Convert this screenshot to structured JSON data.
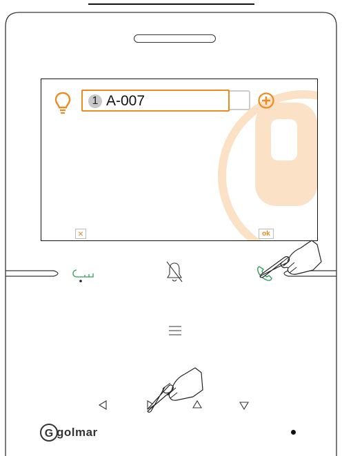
{
  "screen": {
    "entry_index": "1",
    "entry_name": "A-007",
    "cancel_label": "×",
    "ok_label": "ok"
  },
  "brand": {
    "logo_text": "golmar",
    "logo_letter": "G"
  },
  "colors": {
    "accent": "#f0891e",
    "green": "#2e9e5b",
    "watermark": "#fbe1c6",
    "outline": "#333333"
  },
  "icons": {
    "lamp": "lightbulb-icon",
    "add": "plus-circle-icon",
    "key": "key-icon",
    "bell": "bell-off-icon",
    "phone": "phone-icon",
    "menu": "menu-icon"
  }
}
